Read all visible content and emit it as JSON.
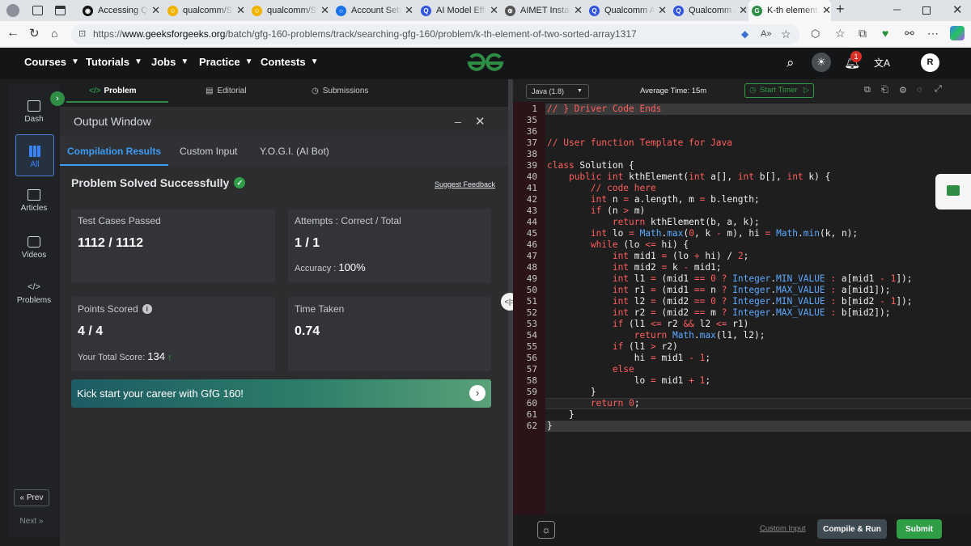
{
  "browser": {
    "tabs": [
      {
        "title": "Accessing Qu",
        "fav_color": "#111111",
        "fav_glyph": "◉"
      },
      {
        "title": "qualcomm/St",
        "fav_color": "#f0b400",
        "fav_glyph": "☺"
      },
      {
        "title": "qualcomm/St",
        "fav_color": "#f0b400",
        "fav_glyph": "☺"
      },
      {
        "title": "Account Setti",
        "fav_color": "#1a73e8",
        "fav_glyph": "○"
      },
      {
        "title": "AI Model Effi",
        "fav_color": "#3253dc",
        "fav_glyph": "Q"
      },
      {
        "title": "AIMET Install",
        "fav_color": "#555555",
        "fav_glyph": "⊕"
      },
      {
        "title": "Qualcomm A",
        "fav_color": "#3253dc",
        "fav_glyph": "Q"
      },
      {
        "title": "Qualcomm A",
        "fav_color": "#3253dc",
        "fav_glyph": "Q"
      },
      {
        "title": "K-th element",
        "fav_color": "#2f8d46",
        "fav_glyph": "G"
      }
    ],
    "url_prefix": "https://",
    "url_domain": "www.geeksforgeeks.org",
    "url_path": "/batch/gfg-160-problems/track/searching-gfg-160/problem/k-th-element-of-two-sorted-array1317"
  },
  "nav": {
    "items": [
      "Courses",
      "Tutorials",
      "Jobs",
      "Practice",
      "Contests"
    ],
    "logo": "GfG",
    "notification_count": "1",
    "avatar_letter": "R"
  },
  "sidebar": {
    "items": [
      "Dash",
      "All",
      "Articles",
      "Videos",
      "Problems"
    ],
    "prev": "Prev",
    "next": "Next"
  },
  "problem_tabs": {
    "problem": "Problem",
    "editorial": "Editorial",
    "submissions": "Submissions"
  },
  "output": {
    "title": "Output Window",
    "tabs": [
      "Compilation Results",
      "Custom Input",
      "Y.O.G.I. (AI Bot)"
    ],
    "status": "Problem Solved Successfully",
    "suggest_feedback": "Suggest Feedback",
    "test_cases_label": "Test Cases Passed",
    "test_cases_value": "1112 / 1112",
    "attempts_label": "Attempts : Correct / Total",
    "attempts_value": "1 / 1",
    "accuracy_label": "Accuracy :",
    "accuracy_value": "100%",
    "points_label": "Points Scored",
    "points_value": "4 / 4",
    "total_score_label": "Your Total Score:",
    "total_score_value": "134",
    "time_label": "Time Taken",
    "time_value": "0.74",
    "banner": "Kick start your career with GfG 160!"
  },
  "editor": {
    "language": "Java (1.8)",
    "average_time": "Average Time: 15m",
    "start_timer": "Start Timer",
    "line_numbers": [
      "1",
      "35",
      "36",
      "37",
      "38",
      "39",
      "40",
      "41",
      "42",
      "43",
      "44",
      "45",
      "46",
      "47",
      "48",
      "49",
      "50",
      "51",
      "52",
      "53",
      "54",
      "55",
      "56",
      "57",
      "58",
      "59",
      "60",
      "61",
      "62"
    ],
    "code_lines": [
      "// } Driver Code Ends",
      "",
      "",
      "// User function Template for Java",
      "",
      "class Solution {",
      "    public int kthElement(int a[], int b[], int k) {",
      "        // code here",
      "        int n = a.length, m = b.length;",
      "        if (n > m)",
      "            return kthElement(b, a, k);",
      "        int lo = Math.max(0, k - m), hi = Math.min(k, n);",
      "        while (lo <= hi) {",
      "            int mid1 = (lo + hi) / 2;",
      "            int mid2 = k - mid1;",
      "            int l1 = (mid1 == 0 ? Integer.MIN_VALUE : a[mid1 - 1]);",
      "            int r1 = (mid1 == n ? Integer.MAX_VALUE : a[mid1]);",
      "            int l2 = (mid2 == 0 ? Integer.MIN_VALUE : b[mid2 - 1]);",
      "            int r2 = (mid2 == m ? Integer.MAX_VALUE : b[mid2]);",
      "            if (l1 <= r2 && l2 <= r1)",
      "                return Math.max(l1, l2);",
      "            if (l1 > r2)",
      "                hi = mid1 - 1;",
      "            else",
      "                lo = mid1 + 1;",
      "        }",
      "        return 0;",
      "    }",
      "}"
    ],
    "custom_input": "Custom Input",
    "compile_run": "Compile & Run",
    "submit": "Submit"
  },
  "colors": {
    "gfg_green": "#2f8d46",
    "accent_blue": "#3b82f6",
    "submit_green": "#2f9e47"
  }
}
